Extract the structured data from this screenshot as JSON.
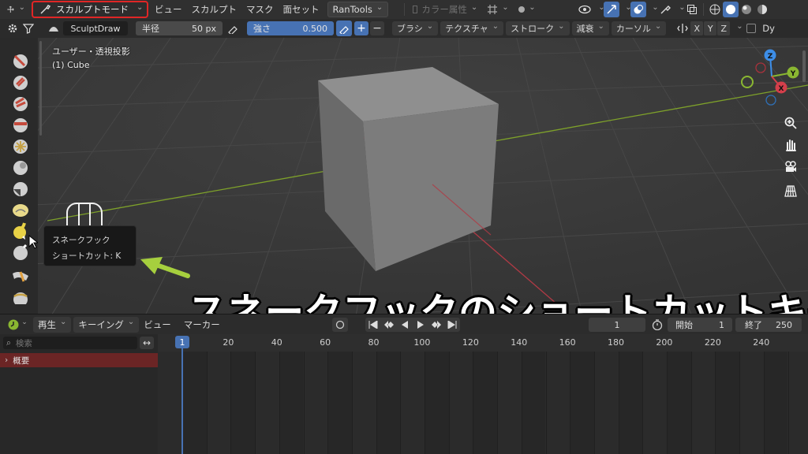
{
  "header": {
    "mode_label": "スカルプトモード",
    "menus": [
      "ビュー",
      "スカルプト",
      "マスク",
      "面セット"
    ],
    "ran_tools": "RanTools",
    "color_attr": "カラー属性"
  },
  "toolbar": {
    "brush_name": "SculptDraw",
    "radius_label": "半径",
    "radius_value": "50 px",
    "strength_label": "強さ",
    "strength_value": "0.500",
    "plus": "+",
    "minus": "−",
    "menus": [
      "ブラシ",
      "テクスチャ",
      "ストローク",
      "減衰",
      "カーソル"
    ],
    "axes": [
      "X",
      "Y",
      "Z"
    ],
    "trailing": "Dy"
  },
  "viewport": {
    "view_label": "ユーザー・透視投影",
    "object_label": "(1) Cube",
    "tooltip_title": "スネークフック",
    "tooltip_shortcut": "ショートカット: K",
    "caption": "スネークフックのショートカットキー",
    "gizmo_axes": [
      "Z",
      "Y",
      "X"
    ]
  },
  "timeline": {
    "menus": [
      "再生",
      "キーイング",
      "ビュー",
      "マーカー"
    ],
    "current_frame": "1",
    "start_label": "開始",
    "start_value": "1",
    "end_label": "終了",
    "end_value": "250",
    "search_placeholder": "検索",
    "summary_label": "概要",
    "frame_marker": "1",
    "ruler_ticks": [
      "20",
      "40",
      "60",
      "80",
      "100",
      "120",
      "140",
      "160",
      "180",
      "200",
      "220",
      "240"
    ]
  },
  "colors": {
    "accent": "#4772b3",
    "highlight_box": "#e02626",
    "summary_row": "#6b2525",
    "x_axis": "#d43f4b",
    "y_axis": "#8ab731",
    "z_axis": "#3d8ee8"
  }
}
